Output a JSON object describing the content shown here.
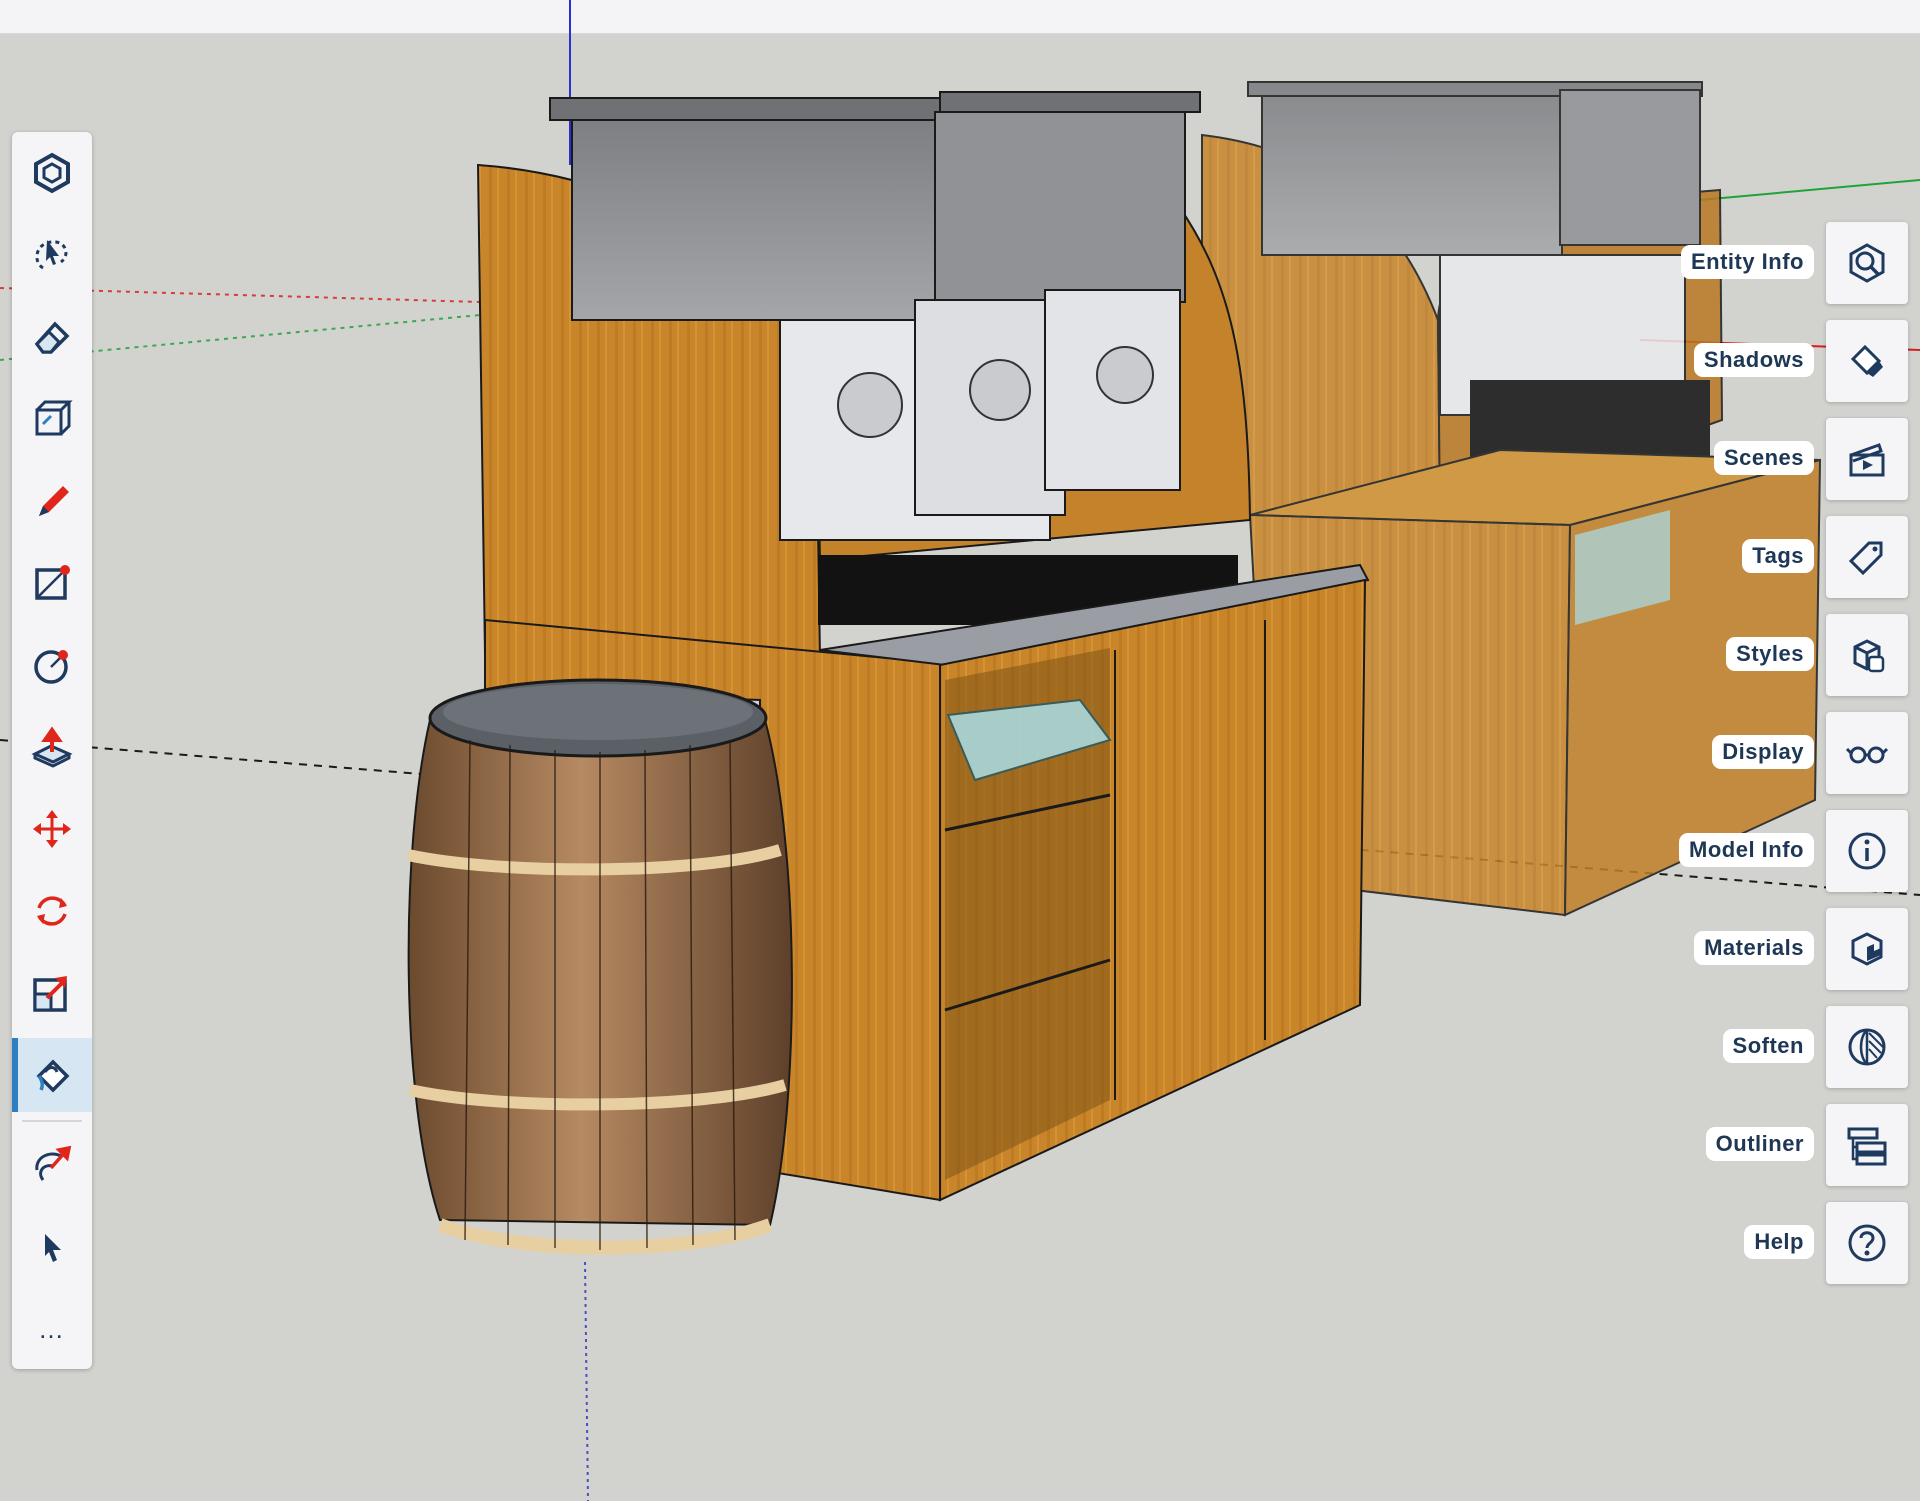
{
  "colors": {
    "accent": "#2f7fc0",
    "icon_ink": "#1e3a5f",
    "tool_red": "#e0261b",
    "wood": "#c9862a",
    "label_text": "#1d3754"
  },
  "toolbar": {
    "items": [
      {
        "icon": "search-tool-icon"
      },
      {
        "icon": "lasso-select-icon"
      },
      {
        "icon": "eraser-icon"
      },
      {
        "icon": "tape-measure-icon"
      },
      {
        "icon": "pencil-icon"
      },
      {
        "icon": "rectangle-icon"
      },
      {
        "icon": "circle-icon"
      },
      {
        "icon": "push-pull-icon"
      },
      {
        "icon": "move-icon"
      },
      {
        "icon": "rotate-icon"
      },
      {
        "icon": "scale-icon"
      },
      {
        "icon": "paint-bucket-icon",
        "active": true
      },
      {
        "icon": "orbit-icon"
      },
      {
        "icon": "cursor-icon"
      }
    ],
    "more_label": "…"
  },
  "panel": {
    "items": [
      {
        "label": "Entity Info",
        "icon": "entity-info-icon"
      },
      {
        "label": "Shadows",
        "icon": "shadows-icon"
      },
      {
        "label": "Scenes",
        "icon": "scenes-icon"
      },
      {
        "label": "Tags",
        "icon": "tags-icon"
      },
      {
        "label": "Styles",
        "icon": "styles-icon"
      },
      {
        "label": "Display",
        "icon": "display-icon"
      },
      {
        "label": "Model Info",
        "icon": "model-info-icon"
      },
      {
        "label": "Materials",
        "icon": "materials-icon"
      },
      {
        "label": "Soften",
        "icon": "soften-icon"
      },
      {
        "label": "Outliner",
        "icon": "outliner-icon"
      },
      {
        "label": "Help",
        "icon": "help-icon"
      }
    ]
  }
}
